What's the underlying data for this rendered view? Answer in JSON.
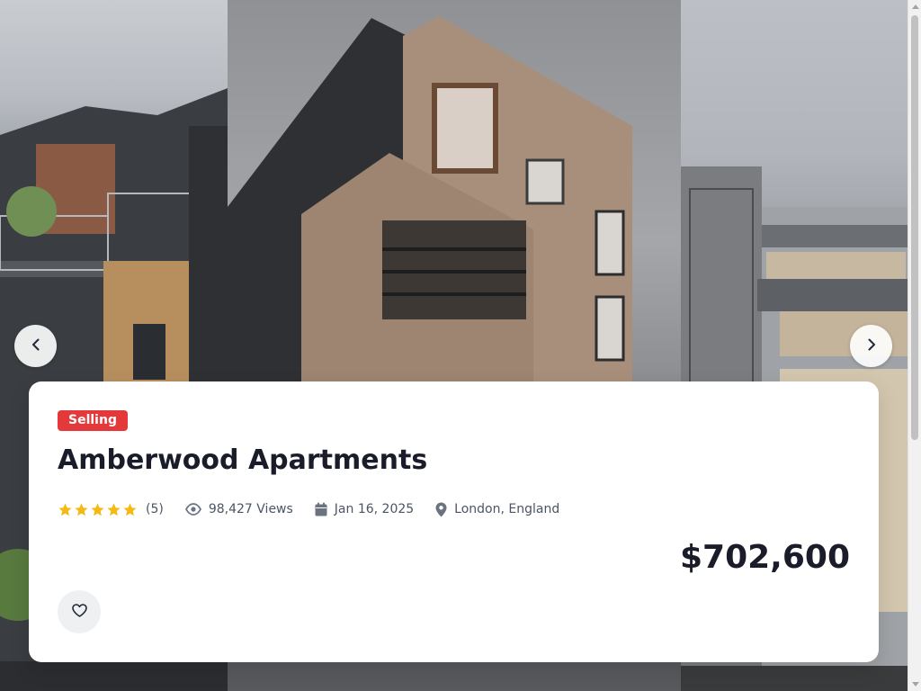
{
  "listing": {
    "status_badge": "Selling",
    "title": "Amberwood Apartments",
    "rating_count": "(5)",
    "rating_value": 5,
    "views": "98,427 Views",
    "date": "Jan 16, 2025",
    "location": "London, England",
    "price": "$702,600"
  },
  "colors": {
    "badge": "#e5383b",
    "star": "#f5b914",
    "title": "#1a1d29"
  },
  "icons": {
    "prev": "chevron-left-icon",
    "next": "chevron-right-icon",
    "views": "eye-icon",
    "date": "calendar-icon",
    "location": "map-pin-icon",
    "favorite": "heart-icon"
  }
}
